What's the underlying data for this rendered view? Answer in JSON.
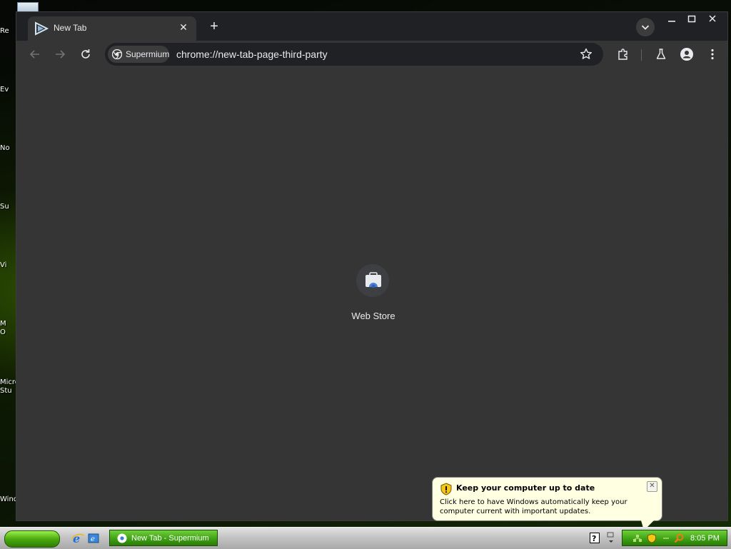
{
  "desktop": {
    "icon_labels": [
      "Re",
      "Ev",
      "No",
      "Su",
      "Vi",
      "M\nO",
      "Micro\nStu",
      "Wind"
    ]
  },
  "browser": {
    "tab_title": "New Tab",
    "tab_icon": "supermium-icon",
    "security_chip": "Supermium",
    "url": "chrome://new-tab-page-third-party",
    "accent_color": "#202124"
  },
  "new_tab_page": {
    "shortcuts": [
      {
        "label": "Web Store",
        "icon": "web-store-icon"
      }
    ]
  },
  "notification": {
    "title": "Keep your computer up to date",
    "body": "Click here to have Windows automatically keep your computer current with important updates.",
    "icon": "shield-warning-icon"
  },
  "taskbar": {
    "task_button_label": "New Tab - Supermium",
    "clock": "8:05 PM"
  }
}
